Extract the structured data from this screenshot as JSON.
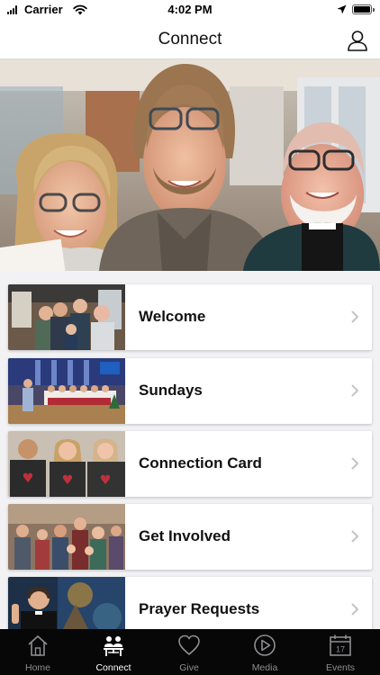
{
  "status_bar": {
    "carrier": "Carrier",
    "time": "4:02 PM"
  },
  "header": {
    "title": "Connect",
    "profile_icon": "person-icon"
  },
  "hero": {
    "description_icon": "group-photo"
  },
  "menu_items": [
    {
      "label": "Welcome"
    },
    {
      "label": "Sundays"
    },
    {
      "label": "Connection Card"
    },
    {
      "label": "Get Involved"
    },
    {
      "label": "Prayer Requests"
    }
  ],
  "tab_bar": {
    "tabs": [
      {
        "label": "Home",
        "icon": "home-icon",
        "active": false
      },
      {
        "label": "Connect",
        "icon": "people-icon",
        "active": true
      },
      {
        "label": "Give",
        "icon": "heart-icon",
        "active": false
      },
      {
        "label": "Media",
        "icon": "play-icon",
        "active": false
      },
      {
        "label": "Events",
        "icon": "calendar-icon",
        "active": false,
        "badge": "17"
      }
    ]
  },
  "colors": {
    "tab_bar_bg": "#070707",
    "tab_inactive": "#8e8e93",
    "tab_active": "#ffffff",
    "list_bg": "#f2f2f4"
  }
}
